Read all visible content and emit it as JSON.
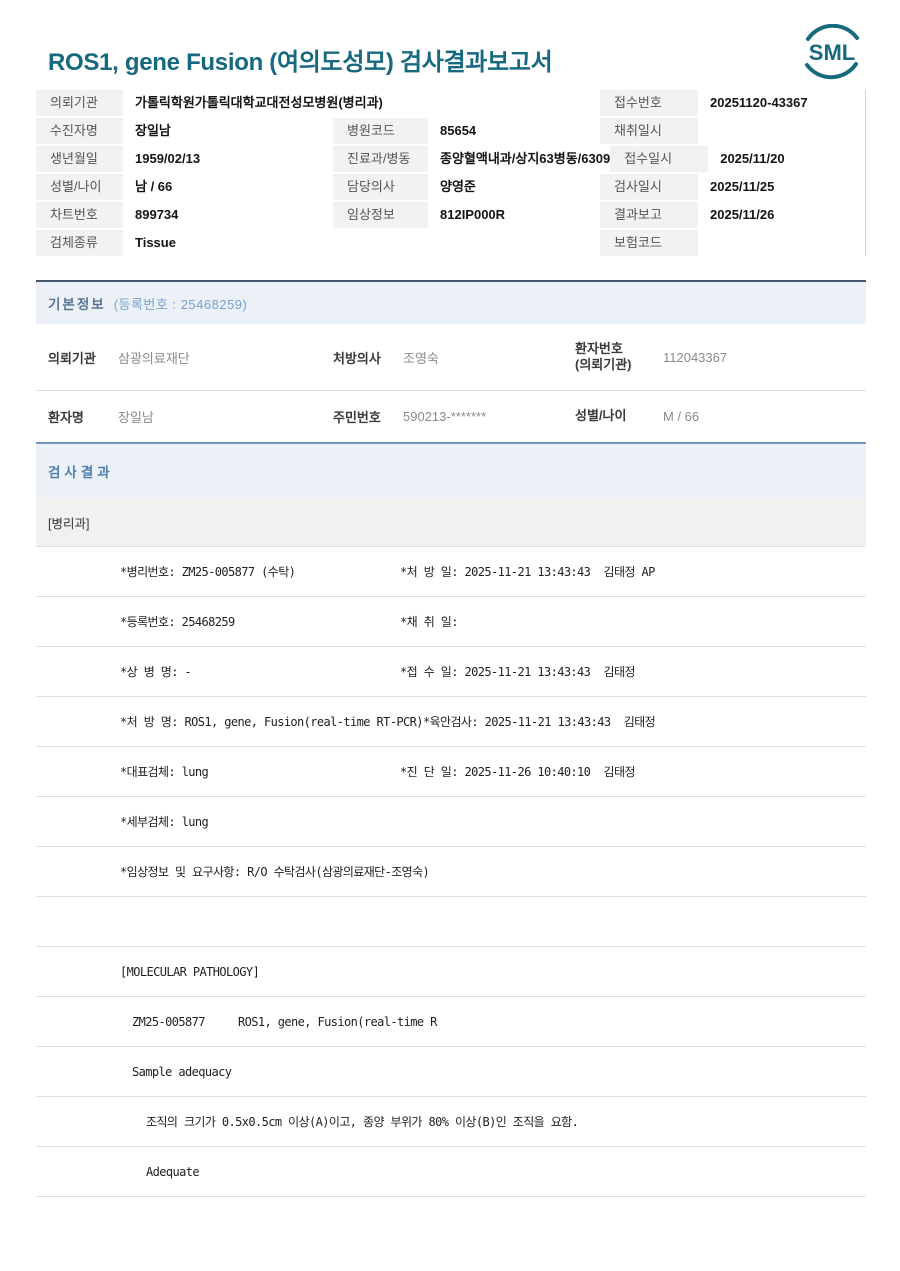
{
  "header": {
    "title": "ROS1, gene Fusion (여의도성모) 검사결과보고서",
    "logo_text": "SML",
    "accent_color": "#16697e"
  },
  "patient_table": {
    "rows": [
      {
        "l1": "의뢰기관",
        "v1": "가톨릭학원가톨릭대학교대전성모병원(병리과)",
        "l3": "접수번호",
        "v3": "20251120-43367"
      },
      {
        "l1": "수진자명",
        "v1": "장일남",
        "l2": "병원코드",
        "v2": "85654",
        "l3": "채취일시",
        "v3": ""
      },
      {
        "l1": "생년월일",
        "v1": "1959/02/13",
        "l2": "진료과/병동",
        "v2": "종양혈액내과/상지63병동/6309",
        "l3": "접수일시",
        "v3": "2025/11/20"
      },
      {
        "l1": "성별/나이",
        "v1": "남 / 66",
        "l2": "담당의사",
        "v2": "양영준",
        "l3": "검사일시",
        "v3": "2025/11/25"
      },
      {
        "l1": "차트번호",
        "v1": "899734",
        "l2": "임상정보",
        "v2": "812IP000R",
        "l3": "결과보고",
        "v3": "2025/11/26"
      },
      {
        "l1": "검체종류",
        "v1": "Tissue",
        "l3": "보험코드",
        "v3": ""
      }
    ]
  },
  "basic_info": {
    "title": "기본정보",
    "subtitle": "(등록번호 : 25468259)",
    "row1": {
      "l1": "의뢰기관",
      "v1": "삼광의료재단",
      "l2": "처방의사",
      "v2": "조영숙",
      "l3_line1": "환자번호",
      "l3_line2": "(의뢰기관)",
      "v3": "112043367"
    },
    "row2": {
      "l1": "환자명",
      "v1": "장일남",
      "l2": "주민번호",
      "v2": "590213-*******",
      "l3": "성별/나이",
      "v3": "M / 66"
    }
  },
  "results": {
    "title": "검사결과",
    "department": "[병리과]",
    "rows": [
      {
        "left": "*병리번호: ZM25-005877 (수탁)",
        "right": "*처 방 일: 2025-11-21 13:43:43  김태정 AP"
      },
      {
        "left": "*등록번호: 25468259",
        "right": "*채 취 일:"
      },
      {
        "left": "*상 병 명: -",
        "right": "*접 수 일: 2025-11-21 13:43:43  김태정"
      },
      {
        "left": "*처 방 명: ROS1, gene, Fusion(real-time RT-PCR)",
        "right": "*육안검사: 2025-11-21 13:43:43  김태정"
      },
      {
        "left": "*대표검체: lung",
        "right": "*진 단 일: 2025-11-26 10:40:10  김태정"
      },
      {
        "left": "*세부검체: lung",
        "right": ""
      },
      {
        "left": "*임상정보 및 요구사항: R/O 수탁검사(삼광의료재단-조영숙)",
        "right": ""
      },
      {
        "left": "",
        "right": ""
      },
      {
        "left": "[MOLECULAR PATHOLOGY]",
        "right": ""
      },
      {
        "left": "ZM25-005877     ROS1, gene, Fusion(real-time R",
        "right": ""
      },
      {
        "left": "Sample adequacy",
        "right": ""
      },
      {
        "left": "조직의 크기가 0.5x0.5cm 이상(A)이고, 종양 부위가 80% 이상(B)인 조직을 요함.",
        "right": ""
      },
      {
        "left": "Adequate",
        "right": ""
      }
    ]
  }
}
